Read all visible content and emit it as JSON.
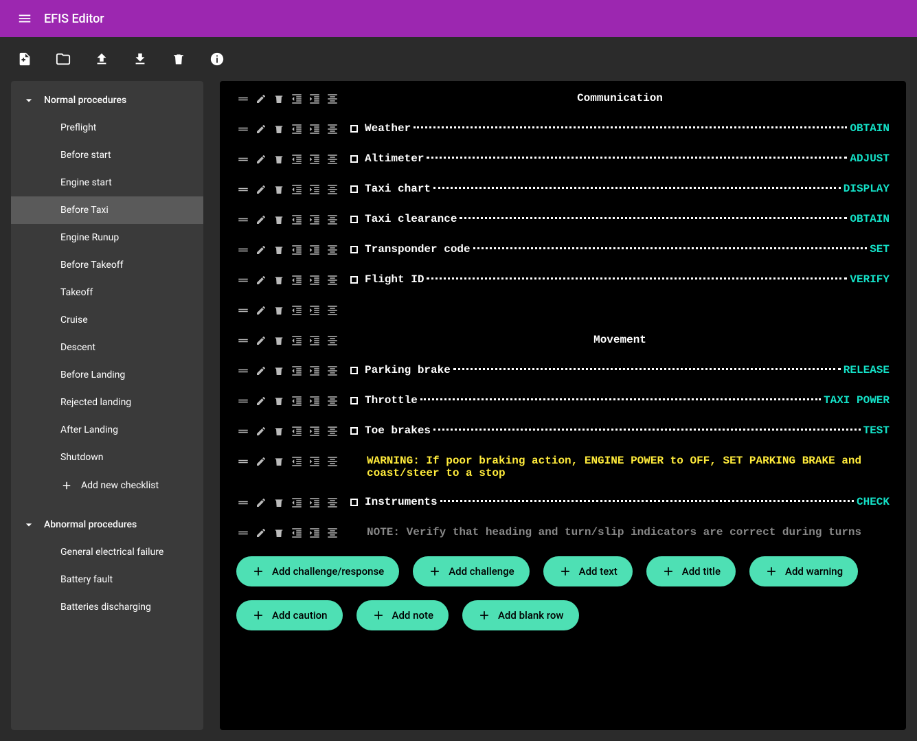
{
  "app": {
    "title": "EFIS Editor"
  },
  "sidebar": {
    "groups": [
      {
        "label": "Normal procedures",
        "items": [
          {
            "label": "Preflight"
          },
          {
            "label": "Before start"
          },
          {
            "label": "Engine start"
          },
          {
            "label": "Before Taxi",
            "active": true
          },
          {
            "label": "Engine Runup"
          },
          {
            "label": "Before Takeoff"
          },
          {
            "label": "Takeoff"
          },
          {
            "label": "Cruise"
          },
          {
            "label": "Descent"
          },
          {
            "label": "Before Landing"
          },
          {
            "label": "Rejected landing"
          },
          {
            "label": "After Landing"
          },
          {
            "label": "Shutdown"
          }
        ],
        "add_label": "Add new checklist"
      },
      {
        "label": "Abnormal procedures",
        "items": [
          {
            "label": "General electrical failure"
          },
          {
            "label": "Battery fault"
          },
          {
            "label": "Batteries discharging"
          }
        ]
      }
    ]
  },
  "checklist": {
    "rows": [
      {
        "type": "title",
        "text": "Communication"
      },
      {
        "type": "cr",
        "challenge": "Weather",
        "response": "OBTAIN"
      },
      {
        "type": "cr",
        "challenge": "Altimeter",
        "response": "ADJUST"
      },
      {
        "type": "cr",
        "challenge": "Taxi chart",
        "response": "DISPLAY"
      },
      {
        "type": "cr",
        "challenge": "Taxi clearance",
        "response": "OBTAIN"
      },
      {
        "type": "cr",
        "challenge": "Transponder code",
        "response": "SET"
      },
      {
        "type": "cr",
        "challenge": "Flight ID",
        "response": "VERIFY"
      },
      {
        "type": "blank"
      },
      {
        "type": "title",
        "text": "Movement"
      },
      {
        "type": "cr",
        "challenge": "Parking brake",
        "response": "RELEASE"
      },
      {
        "type": "cr",
        "challenge": "Throttle",
        "response": "TAXI POWER"
      },
      {
        "type": "cr",
        "challenge": "Toe brakes",
        "response": "TEST"
      },
      {
        "type": "warning",
        "text": "WARNING: If poor braking action, ENGINE POWER to OFF, SET PARKING BRAKE and coast/steer to a stop"
      },
      {
        "type": "cr",
        "challenge": "Instruments",
        "response": "CHECK"
      },
      {
        "type": "note",
        "text": "NOTE: Verify that heading and turn/slip indicators are correct during turns"
      }
    ]
  },
  "add_buttons": [
    "Add challenge/response",
    "Add challenge",
    "Add text",
    "Add title",
    "Add warning",
    "Add caution",
    "Add note",
    "Add blank row"
  ]
}
